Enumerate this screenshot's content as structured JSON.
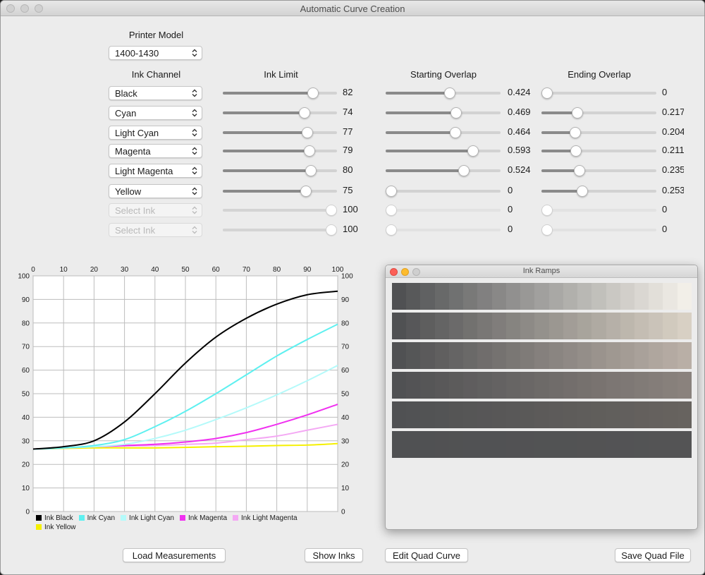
{
  "window": {
    "title": "Automatic Curve Creation"
  },
  "printer": {
    "label": "Printer Model",
    "selected": "1400-1430"
  },
  "headers": {
    "ink_channel": "Ink Channel",
    "ink_limit": "Ink Limit",
    "starting_overlap": "Starting Overlap",
    "ending_overlap": "Ending Overlap"
  },
  "channels": [
    {
      "ink": "Black",
      "enabled": true,
      "limit": 82,
      "limit_text": "82",
      "start": 0.424,
      "start_text": "0.424",
      "end": 0,
      "end_text": "0"
    },
    {
      "ink": "Cyan",
      "enabled": true,
      "limit": 74,
      "limit_text": "74",
      "start": 0.469,
      "start_text": "0.469",
      "end": 0.217,
      "end_text": "0.217"
    },
    {
      "ink": "Light Cyan",
      "enabled": true,
      "limit": 77,
      "limit_text": "77",
      "start": 0.464,
      "start_text": "0.464",
      "end": 0.204,
      "end_text": "0.204"
    },
    {
      "ink": "Magenta",
      "enabled": true,
      "limit": 79,
      "limit_text": "79",
      "start": 0.593,
      "start_text": "0.593",
      "end": 0.211,
      "end_text": "0.211"
    },
    {
      "ink": "Light Magenta",
      "enabled": true,
      "limit": 80,
      "limit_text": "80",
      "start": 0.524,
      "start_text": "0.524",
      "end": 0.235,
      "end_text": "0.235"
    },
    {
      "ink": "Yellow",
      "enabled": true,
      "limit": 75,
      "limit_text": "75",
      "start": 0,
      "start_text": "0",
      "end": 0.253,
      "end_text": "0.253"
    },
    {
      "ink": "Select Ink",
      "enabled": false,
      "limit": 100,
      "limit_text": "100",
      "start": 0,
      "start_text": "0",
      "end": 0,
      "end_text": "0"
    },
    {
      "ink": "Select Ink",
      "enabled": false,
      "limit": 100,
      "limit_text": "100",
      "start": 0,
      "start_text": "0",
      "end": 0,
      "end_text": "0"
    }
  ],
  "chart_data": {
    "type": "line",
    "x_range": [
      0,
      100
    ],
    "y_range": [
      0,
      100
    ],
    "x_ticks": [
      "0",
      "10",
      "20",
      "30",
      "40",
      "50",
      "60",
      "70",
      "80",
      "90",
      "100"
    ],
    "y_ticks": [
      "0",
      "10",
      "20",
      "30",
      "40",
      "50",
      "60",
      "70",
      "80",
      "90",
      "100"
    ],
    "grid": true,
    "legend_position": "bottom",
    "x": [
      0,
      10,
      20,
      30,
      40,
      50,
      60,
      70,
      80,
      90,
      100
    ],
    "series": [
      {
        "name": "Ink Black",
        "color": "#000000",
        "values": [
          26.5,
          27.5,
          30,
          38,
          50,
          63,
          74,
          82,
          88,
          92,
          93.5
        ]
      },
      {
        "name": "Ink Cyan",
        "color": "#5ef0f0",
        "values": [
          26.5,
          27,
          28,
          30.5,
          36,
          42.5,
          50,
          58,
          66,
          73,
          79.5
        ]
      },
      {
        "name": "Ink Light Cyan",
        "color": "#b4fafa",
        "values": [
          26.5,
          27,
          27.5,
          28.5,
          31,
          34.5,
          39,
          44,
          49.5,
          55.5,
          62
        ]
      },
      {
        "name": "Ink Magenta",
        "color": "#f030f0",
        "values": [
          26.5,
          27,
          27.5,
          28,
          28.5,
          29.5,
          31,
          33.5,
          37,
          41,
          45.5
        ]
      },
      {
        "name": "Ink Light Magenta",
        "color": "#f4a8f4",
        "values": [
          26.5,
          27,
          27.5,
          27.8,
          28,
          28.5,
          29,
          30.5,
          32,
          34.5,
          37
        ]
      },
      {
        "name": "Ink Yellow",
        "color": "#f5f000",
        "values": [
          26.5,
          26.8,
          27,
          27,
          27,
          27.2,
          27.5,
          27.7,
          28,
          28.2,
          28.8
        ]
      }
    ]
  },
  "ink_ramps": {
    "title": "Ink Ramps",
    "ramps": [
      {
        "start": "#505153",
        "end": "#f2efe8"
      },
      {
        "start": "#505153",
        "end": "#d8d0c4"
      },
      {
        "start": "#505153",
        "end": "#b9afa6"
      },
      {
        "start": "#505153",
        "end": "#8a827d"
      },
      {
        "start": "#505153",
        "end": "#67635f"
      },
      {
        "start": "#505153",
        "end": "#545455"
      }
    ],
    "steps": 21
  },
  "buttons": {
    "load_measurements": "Load Measurements",
    "show_inks": "Show Inks",
    "edit_quad_curve": "Edit Quad Curve",
    "save_quad_file": "Save Quad File"
  }
}
